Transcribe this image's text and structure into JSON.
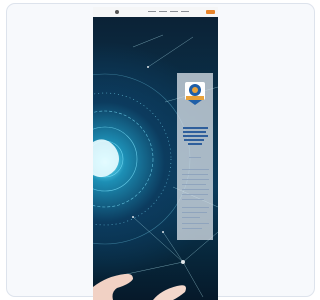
{
  "thumbnail": {
    "nav_items": [
      "",
      "",
      "",
      ""
    ],
    "cta_label": "",
    "panel": {
      "badge_icon": "award-badge-icon",
      "heading": "",
      "body": ""
    }
  },
  "colors": {
    "card_border": "#dde3ec",
    "card_bg": "#f7f9fc",
    "cta": "#e8842a",
    "hero_glow": "#5fdcf3",
    "panel_bg": "#d6dee6",
    "badge_blue": "#1f5fa8",
    "badge_gold": "#e8a23a"
  }
}
